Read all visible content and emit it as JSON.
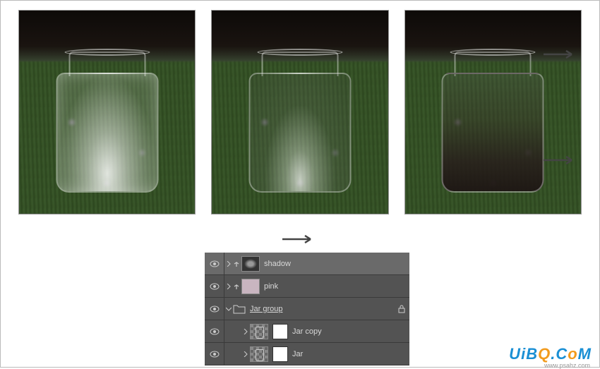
{
  "layers": {
    "shadow": "shadow",
    "pink": "pink",
    "jar_group": "Jar group",
    "jar_copy": "Jar copy",
    "jar": "Jar"
  },
  "icons": {
    "eye": "eye-icon",
    "chevron_right": "chevron-right",
    "chevron_down": "chevron-down",
    "clip": "clip-mask",
    "folder": "folder",
    "lock": "lock"
  },
  "watermark": {
    "text_u": "U",
    "text_i": "i",
    "text_b": "B",
    "text_q": "Q",
    "text_c": "C",
    "text_o2": "o",
    "text_m": "M",
    "dot": ".",
    "sub": "www.psahz.com"
  }
}
